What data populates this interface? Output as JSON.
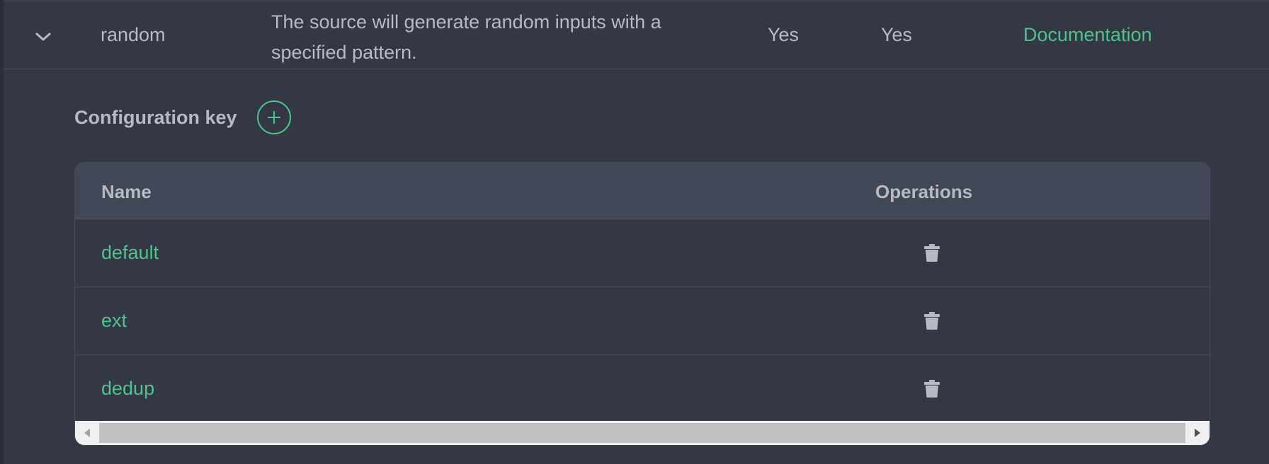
{
  "source": {
    "name": "random",
    "description": "The source will generate random inputs with a specified pattern.",
    "col_yes_1": "Yes",
    "col_yes_2": "Yes",
    "documentation_link": "Documentation"
  },
  "config": {
    "title": "Configuration key",
    "table": {
      "headers": {
        "name": "Name",
        "operations": "Operations"
      },
      "rows": [
        {
          "name": "default",
          "operation_icon": "trash-icon"
        },
        {
          "name": "ext",
          "operation_icon": "trash-icon"
        },
        {
          "name": "dedup",
          "operation_icon": "trash-icon"
        }
      ]
    }
  },
  "colors": {
    "background": "#343844",
    "accent": "#4cc38a",
    "text": "#b6bac3",
    "header_bg": "#424756"
  }
}
